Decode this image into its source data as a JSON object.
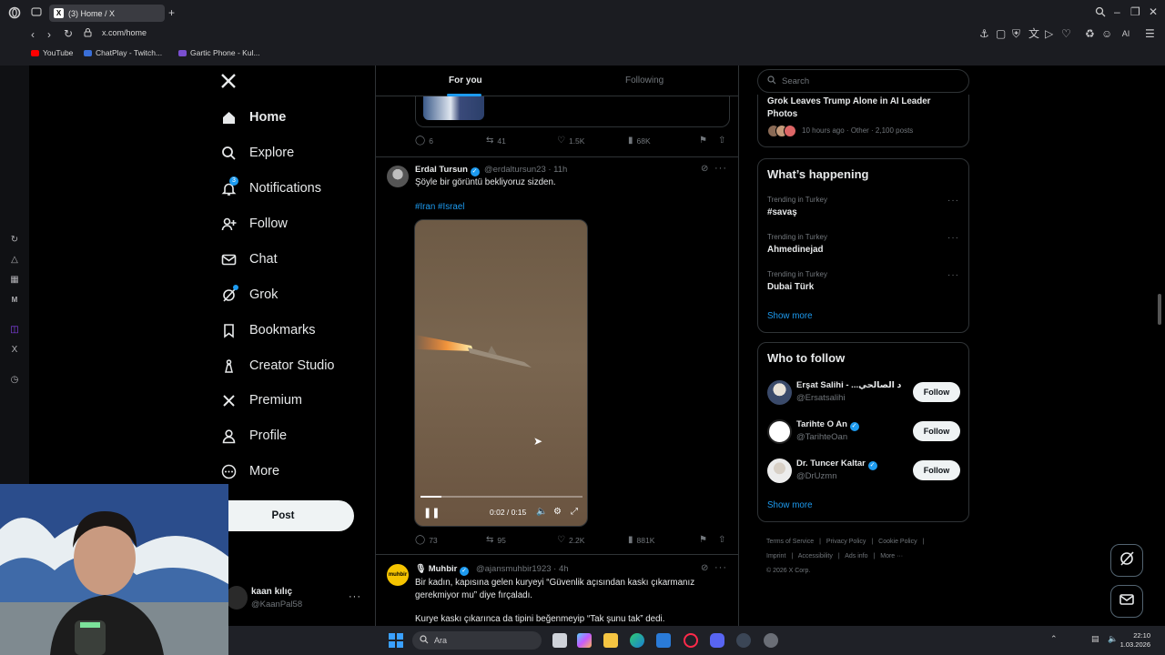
{
  "browser": {
    "tab_title": "(3) Home / X",
    "url": "x.com/home",
    "bookmarks": [
      {
        "label": "YouTube",
        "color": "#ff0000"
      },
      {
        "label": "ChatPlay - Twitch...",
        "color": "#3a6fd8"
      },
      {
        "label": "Gartic Phone - Kul...",
        "color": "#7a4fd0"
      }
    ],
    "toolbar_ai_label": "AI"
  },
  "nav": {
    "items": [
      {
        "label": "Home",
        "icon": "home-icon"
      },
      {
        "label": "Explore",
        "icon": "search-icon"
      },
      {
        "label": "Notifications",
        "icon": "bell-icon",
        "badge": "3"
      },
      {
        "label": "Follow",
        "icon": "person-add-icon"
      },
      {
        "label": "Chat",
        "icon": "mail-icon"
      },
      {
        "label": "Grok",
        "icon": "grok-icon"
      },
      {
        "label": "Bookmarks",
        "icon": "bookmark-icon"
      },
      {
        "label": "Creator Studio",
        "icon": "creator-icon"
      },
      {
        "label": "Premium",
        "icon": "x-icon"
      },
      {
        "label": "Profile",
        "icon": "person-icon"
      },
      {
        "label": "More",
        "icon": "more-circle-icon"
      }
    ],
    "post_label": "Post",
    "account": {
      "name": "kaan kılıç",
      "handle": "@KaanPal58"
    }
  },
  "feed": {
    "tabs": [
      "For you",
      "Following"
    ],
    "prev_tweet_actions": {
      "replies": "6",
      "reposts": "41",
      "likes": "1.5K",
      "views": "68K"
    },
    "tweet1": {
      "name": "Erdal Tursun",
      "handle": "@erdaltursun23 · 11h",
      "text": "Şöyle bir görüntü bekliyoruz sizden.",
      "hashtags": "#Iran #Israel",
      "video": {
        "time": "0:02 / 0:15",
        "progress": 0.13
      },
      "actions": {
        "replies": "73",
        "reposts": "95",
        "likes": "2.2K",
        "views": "881K"
      }
    },
    "tweet2": {
      "name": "Muhbir",
      "handle": "@ajansmuhbir1923 · 4h",
      "avatar_text": "muhbir",
      "line1": "Bir kadın, kapısına gelen kuryeyi “Güvenlik açısından kaskı çıkarmanız",
      "line2": "gerekmiyor mu” diye fırçaladı.",
      "line3": "Kurye kaskı çıkarınca da tipini beğenmeyip “Tak şunu tak” dedi."
    }
  },
  "right": {
    "search_placeholder": "Search",
    "news": {
      "title": "Grok Leaves Trump Alone in AI Leader Photos",
      "meta": "10 hours ago · Other · 2,100 posts"
    },
    "happening": {
      "title": "What’s happening",
      "trends": [
        {
          "category": "Trending in Turkey",
          "name": "#savaş"
        },
        {
          "category": "Trending in Turkey",
          "name": "Ahmedinejad"
        },
        {
          "category": "Trending in Turkey",
          "name": "Dubai Türk"
        }
      ],
      "show_more": "Show more"
    },
    "who_to_follow": {
      "title": "Who to follow",
      "users": [
        {
          "name": "Erşat Salihi - ...د الصالحي",
          "handle": "@Ersatsalihi",
          "verified": false,
          "follow": "Follow"
        },
        {
          "name": "Tarihte O An",
          "handle": "@TarihteOan",
          "verified": true,
          "follow": "Follow"
        },
        {
          "name": "Dr. Tuncer Kaltar",
          "handle": "@DrUzmn",
          "verified": true,
          "follow": "Follow"
        }
      ],
      "show_more": "Show more"
    },
    "footer": {
      "links": [
        "Terms of Service",
        "|",
        "Privacy Policy",
        "|",
        "Cookie Policy",
        "|",
        "Imprint",
        "|",
        "Accessibility",
        "|",
        "Ads info",
        "|",
        "More ···"
      ],
      "copyright": "© 2026 X Corp."
    }
  },
  "taskbar": {
    "search_placeholder": "Ara",
    "time": "22:10",
    "date": "1.03.2026"
  }
}
